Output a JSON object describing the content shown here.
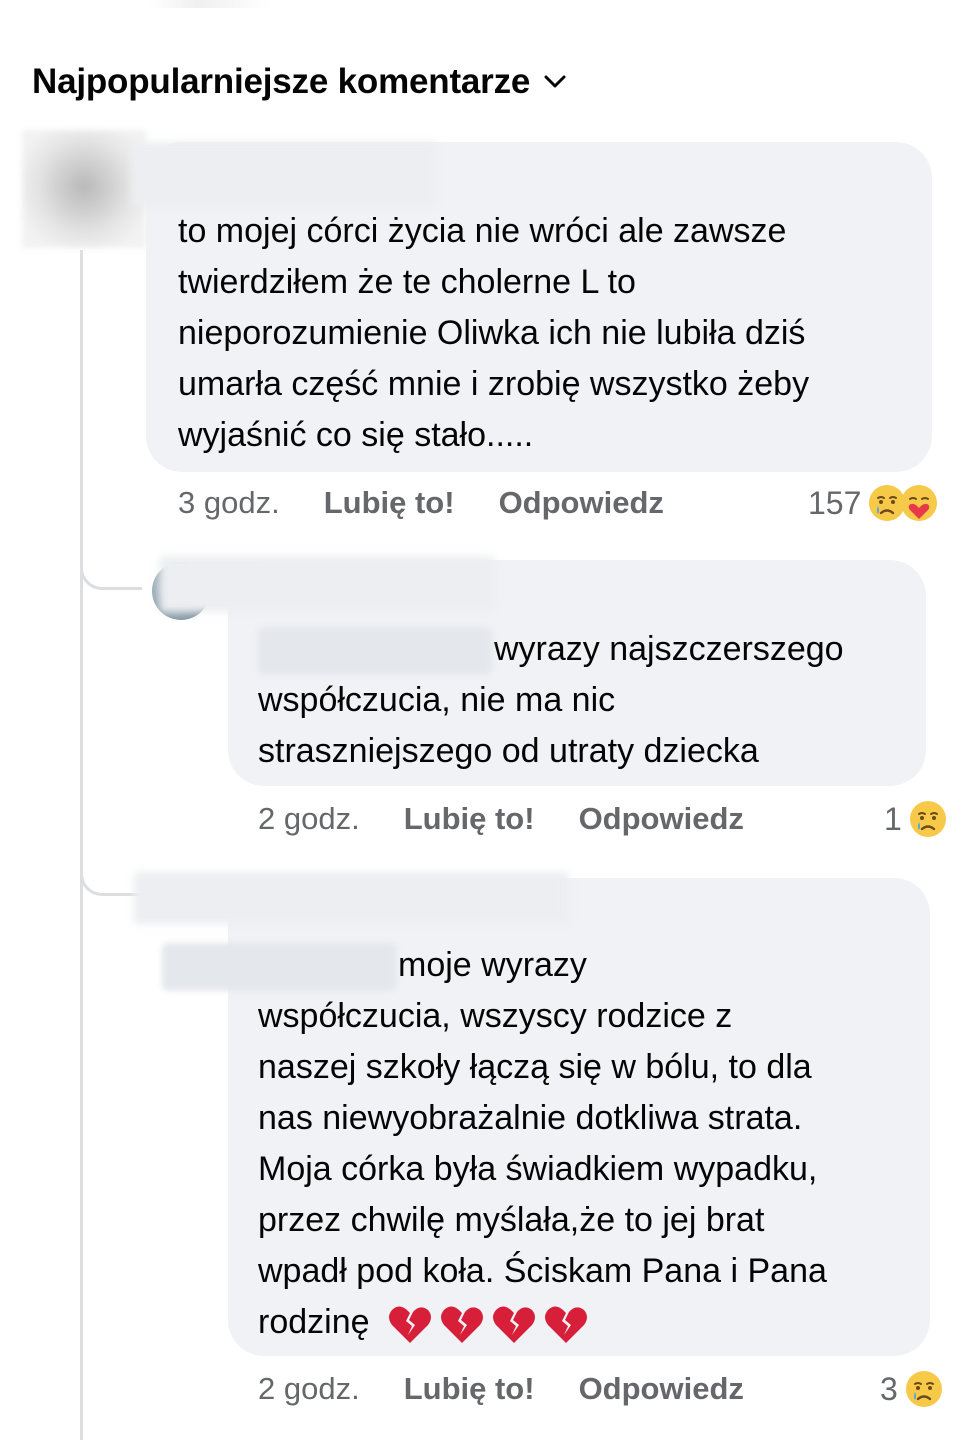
{
  "header": {
    "title": "Najpopularniejsze komentarze"
  },
  "comments": [
    {
      "lines": [
        "to mojej córci życia nie wróci ale zawsze",
        "twierdziłem że te cholerne L to",
        "nieporozumienie Oliwka ich nie lubiła dziś",
        "umarła część mnie i zrobię wszystko żeby",
        "wyjaśnić co się stało....."
      ],
      "time": "3 godz.",
      "like_label": "Lubię to!",
      "reply_label": "Odpowiedz",
      "reaction_count": "157",
      "reactions": [
        "sad-crying-face",
        "hugging-heart-face"
      ]
    },
    {
      "first_line_after_redaction": "wyrazy najszczerszego",
      "lines": [
        "współczucia, nie ma nic",
        "straszniejszego od utraty dziecka"
      ],
      "time": "2 godz.",
      "like_label": "Lubię to!",
      "reply_label": "Odpowiedz",
      "reaction_count": "1",
      "reactions": [
        "sad-crying-face"
      ]
    },
    {
      "first_line_after_redaction": "moje wyrazy",
      "lines": [
        "współczucia,  wszyscy rodzice z",
        "naszej szkoły łączą się w bólu, to dla",
        "nas niewyobrażalnie  dotkliwa strata.",
        "Moja córka była świadkiem wypadku,",
        "przez chwilę myślała,że to jej brat",
        "wpadł pod koła. Ściskam Pana i Pana",
        "rodzinę"
      ],
      "trailing_emoji": [
        "broken-heart",
        "broken-heart",
        "broken-heart",
        "broken-heart"
      ],
      "time": "2 godz.",
      "like_label": "Lubię to!",
      "reply_label": "Odpowiedz",
      "reaction_count": "3",
      "reactions": [
        "sad-crying-face"
      ]
    }
  ],
  "colors": {
    "bubble": "#f0f2f5",
    "meta_text": "#65676b",
    "thread_line": "#dcdee2"
  }
}
